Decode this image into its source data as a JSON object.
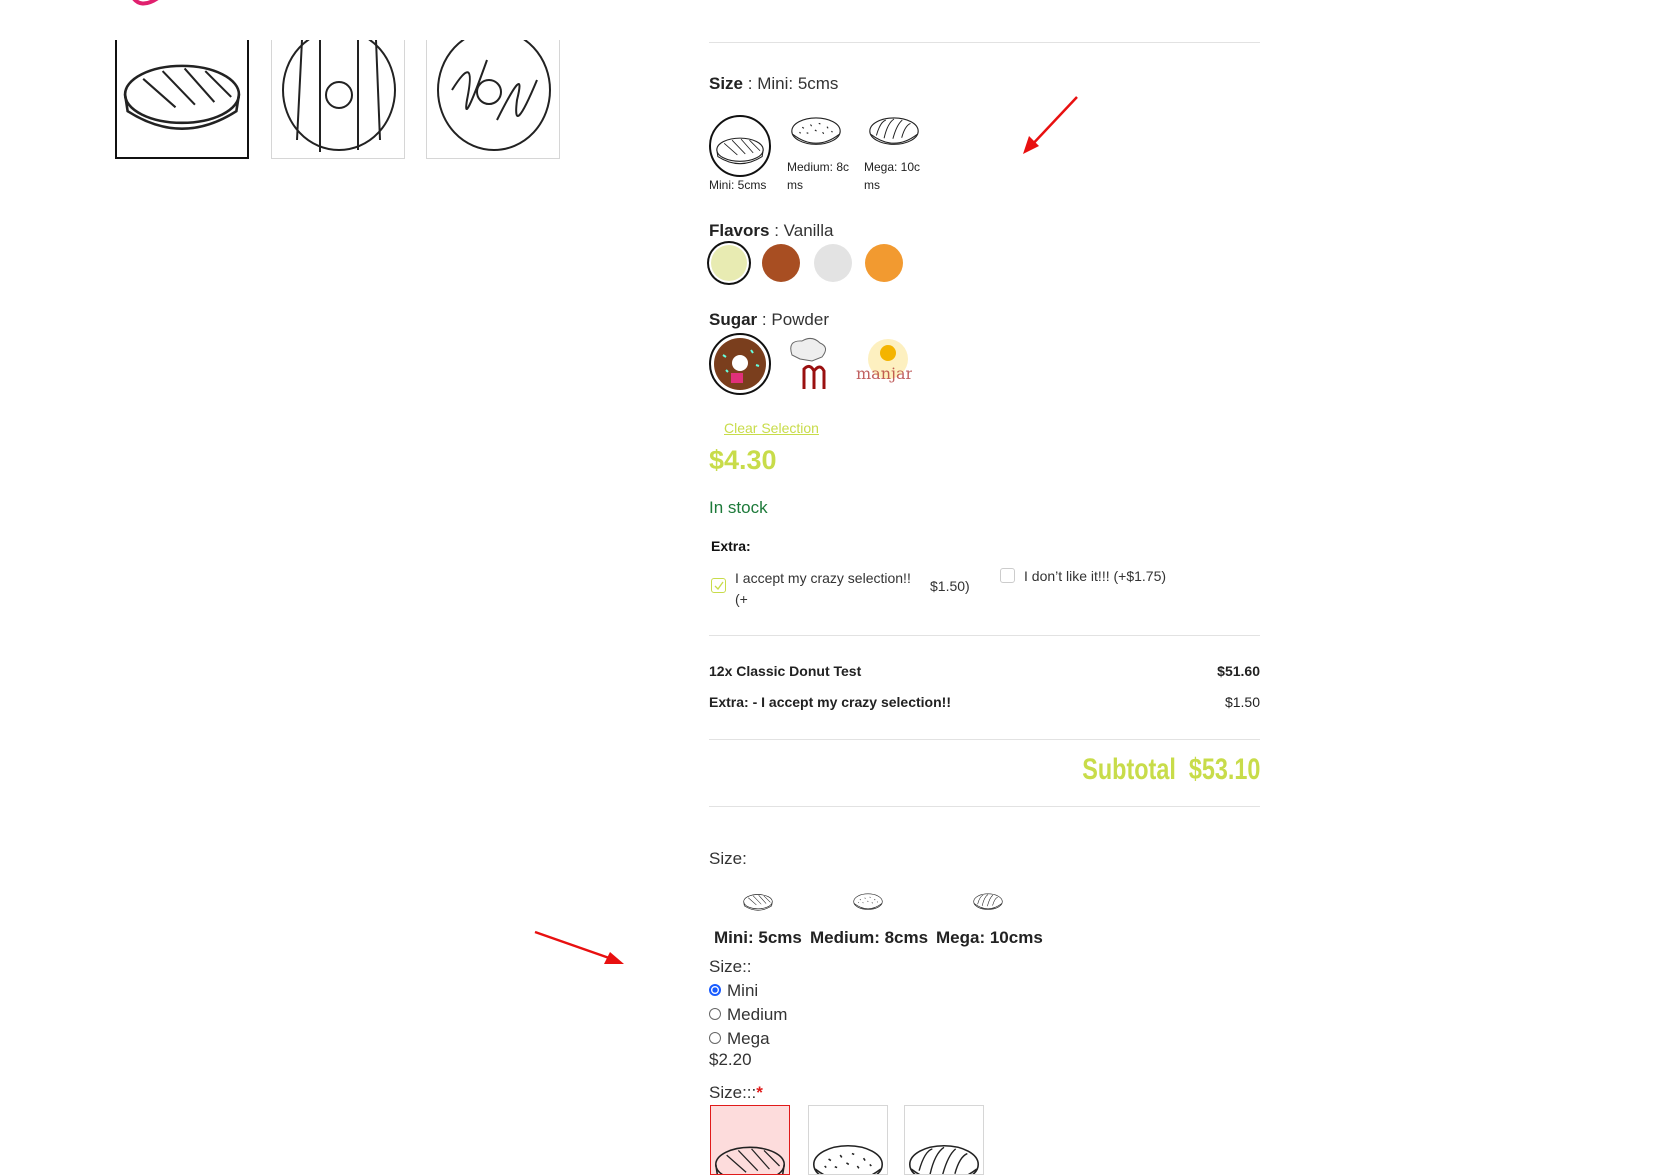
{
  "gallery": {
    "thumbnails": [
      {
        "name": "classic-donut-thumb",
        "selected": true
      },
      {
        "name": "striped-donut-thumb",
        "selected": false
      },
      {
        "name": "swirl-donut-thumb",
        "selected": false
      }
    ]
  },
  "size": {
    "label": "Size",
    "value": "Mini: 5cms",
    "options": [
      {
        "label": "Mini: 5cms",
        "selected": true
      },
      {
        "label": "Medium: 8cms",
        "selected": false
      },
      {
        "label": "Mega: 10cms",
        "selected": false
      }
    ]
  },
  "flavors": {
    "label": "Flavors",
    "value": "Vanilla",
    "swatches": [
      {
        "color": "#e8ebb2",
        "selected": true
      },
      {
        "color": "#a84e22",
        "selected": false
      },
      {
        "color": "#e3e3e3",
        "selected": false
      },
      {
        "color": "#f29a30",
        "selected": false
      }
    ]
  },
  "sugar": {
    "label": "Sugar",
    "value": "Powder",
    "options": [
      {
        "icon": "sprinkle-donut-image",
        "selected": true
      },
      {
        "icon": "chef-hat-logo-image",
        "selected": false
      },
      {
        "icon": "manjare-logo-image",
        "selected": false
      }
    ]
  },
  "clear_selection": "Clear Selection",
  "price": "$4.30",
  "stock": "In stock",
  "extra": {
    "label": "Extra:",
    "options": [
      {
        "text_a": "I accept my crazy selection!!",
        "text_b": "(+",
        "price": "$1.50)",
        "checked": true
      },
      {
        "text": "I don’t like it!!! (+$1.75)",
        "checked": false
      }
    ]
  },
  "summary": {
    "rows": [
      {
        "label": "12x Classic Donut Test",
        "value": "$51.60"
      },
      {
        "label": "Extra: - I accept my crazy selection!!",
        "value": "$1.50"
      }
    ],
    "subtotal_label": "Subtotal",
    "subtotal_value": "$53.10"
  },
  "size_images": {
    "label": "Size:",
    "options": [
      "Mini: 5cms",
      "Medium: 8cms",
      "Mega: 10cms"
    ]
  },
  "size_radio": {
    "label": "Size::",
    "options": [
      {
        "label": "Mini",
        "checked": true
      },
      {
        "label": "Medium",
        "checked": false
      },
      {
        "label": "Mega",
        "checked": false
      }
    ],
    "price": "$2.20"
  },
  "size_boxes": {
    "label": "Size:::",
    "required": "*",
    "selected_index": 0
  },
  "colors": {
    "accent": "#c8dc4a",
    "stock": "#1d7a3a",
    "required": "#e01a1a",
    "arrow": "#e81010"
  }
}
